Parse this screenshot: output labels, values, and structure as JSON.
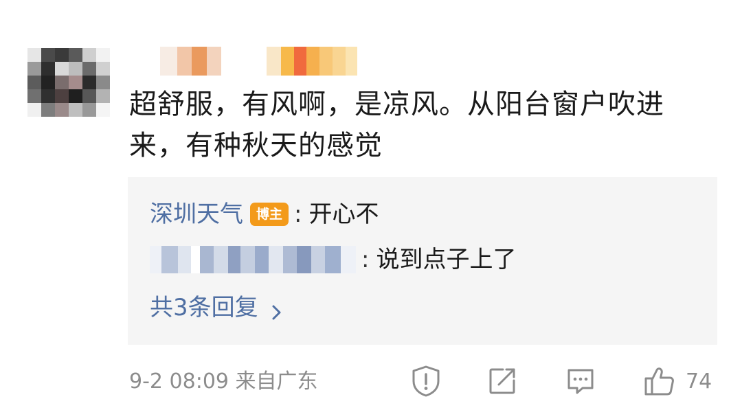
{
  "comment": {
    "text": "超舒服，有风啊，是凉风。从阳台窗户吹进来，有种秋天的感觉"
  },
  "replies": {
    "first": {
      "name": "深圳天气",
      "badge": "博主",
      "colon": ":",
      "text": "开心不"
    },
    "second": {
      "colon": ":",
      "text": "说到点子上了"
    },
    "more_label": "共3条回复"
  },
  "footer": {
    "meta": "9-2 08:09 来自广东",
    "like_count": "74"
  },
  "icons": {
    "report": "report-icon",
    "share": "share-icon",
    "comment": "comment-icon",
    "like": "thumbs-up-icon",
    "more_chevron": "chevron-right-icon"
  },
  "colors": {
    "link_blue": "#4f6fa3",
    "badge_orange": "#f39a1a",
    "meta_gray": "#8c8c8c",
    "reply_bg": "#f5f5f5"
  }
}
